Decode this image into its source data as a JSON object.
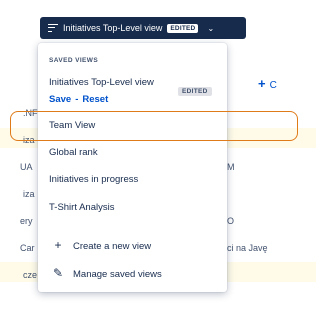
{
  "header": {
    "view_button_label": "Initiatives Top-Level view",
    "view_button_badge": "EDITED"
  },
  "background": {
    "plus_label": "C",
    "fragments": {
      "nf": ".NF",
      "iza1": "iza",
      "ua": "UA",
      "m": "M",
      "iza2": "iza",
      "ery": "ery",
      "o": "O",
      "car": "Car",
      "ci_na": "ci na Javę",
      "cze": "cze"
    }
  },
  "dropdown": {
    "section_title": "SAVED VIEWS",
    "current_view": {
      "name": "Initiatives Top-Level view",
      "badge": "EDITED",
      "save_label": "Save",
      "separator": "-",
      "reset_label": "Reset"
    },
    "views": [
      {
        "label": "Team View"
      },
      {
        "label": "Global rank"
      },
      {
        "label": "Initiatives in progress"
      },
      {
        "label": "T-Shirt Analysis"
      }
    ],
    "actions": [
      {
        "label": "Create a new view",
        "icon": "plus-icon"
      },
      {
        "label": "Manage saved views",
        "icon": "pencil-icon"
      }
    ]
  },
  "colors": {
    "trigger_bg": "#172b4d",
    "link": "#0052cc",
    "highlight": "#e07b1a",
    "band": "#fffbe8"
  }
}
